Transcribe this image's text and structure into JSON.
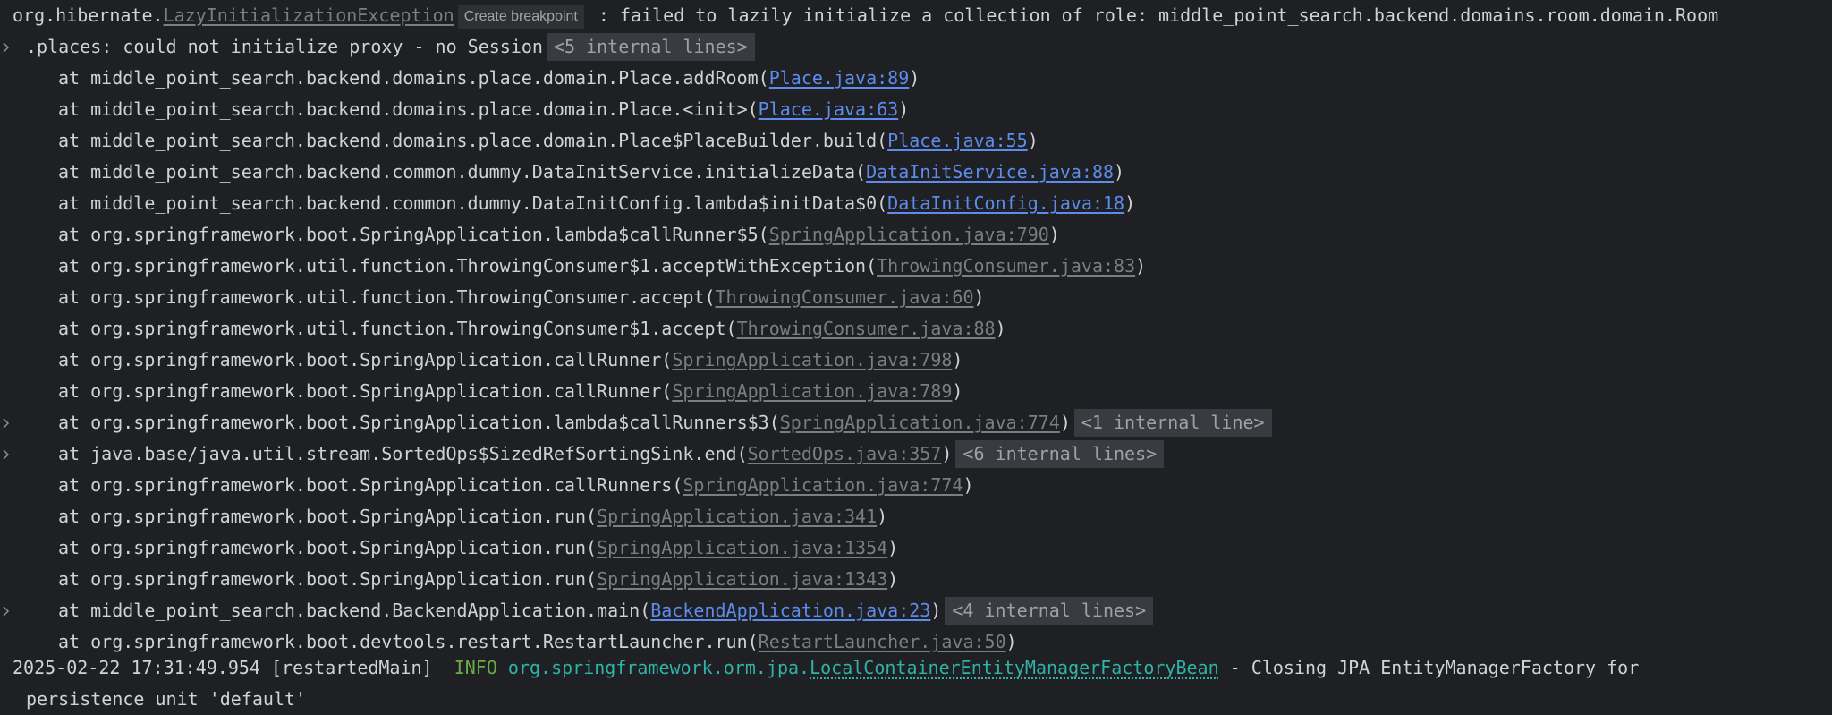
{
  "exception": {
    "prefix": "org.hibernate.",
    "class_link": "LazyInitializationException",
    "breakpoint_label": "Create breakpoint",
    "message_line1": " : failed to lazily initialize a collection of role: middle_point_search.backend.domains.room.domain.Room",
    "message_line2": ".places: could not initialize proxy - no Session",
    "internal_lines": "<5 internal lines>"
  },
  "stack": [
    {
      "method": "at middle_point_search.backend.domains.place.domain.Place.addRoom(",
      "link": "Place.java:89",
      "kind": "user",
      "suffix": ")",
      "internal": ""
    },
    {
      "method": "at middle_point_search.backend.domains.place.domain.Place.<init>(",
      "link": "Place.java:63",
      "kind": "user",
      "suffix": ")",
      "internal": ""
    },
    {
      "method": "at middle_point_search.backend.domains.place.domain.Place$PlaceBuilder.build(",
      "link": "Place.java:55",
      "kind": "user",
      "suffix": ")",
      "internal": ""
    },
    {
      "method": "at middle_point_search.backend.common.dummy.DataInitService.initializeData(",
      "link": "DataInitService.java:88",
      "kind": "user",
      "suffix": ")",
      "internal": ""
    },
    {
      "method": "at middle_point_search.backend.common.dummy.DataInitConfig.lambda$initData$0(",
      "link": "DataInitConfig.java:18",
      "kind": "user",
      "suffix": ")",
      "internal": ""
    },
    {
      "method": "at org.springframework.boot.SpringApplication.lambda$callRunner$5(",
      "link": "SpringApplication.java:790",
      "kind": "lib",
      "suffix": ")",
      "internal": ""
    },
    {
      "method": "at org.springframework.util.function.ThrowingConsumer$1.acceptWithException(",
      "link": "ThrowingConsumer.java:83",
      "kind": "lib",
      "suffix": ")",
      "internal": ""
    },
    {
      "method": "at org.springframework.util.function.ThrowingConsumer.accept(",
      "link": "ThrowingConsumer.java:60",
      "kind": "lib",
      "suffix": ")",
      "internal": ""
    },
    {
      "method": "at org.springframework.util.function.ThrowingConsumer$1.accept(",
      "link": "ThrowingConsumer.java:88",
      "kind": "lib",
      "suffix": ")",
      "internal": ""
    },
    {
      "method": "at org.springframework.boot.SpringApplication.callRunner(",
      "link": "SpringApplication.java:798",
      "kind": "lib",
      "suffix": ")",
      "internal": ""
    },
    {
      "method": "at org.springframework.boot.SpringApplication.callRunner(",
      "link": "SpringApplication.java:789",
      "kind": "lib",
      "suffix": ")",
      "internal": ""
    },
    {
      "method": "at org.springframework.boot.SpringApplication.lambda$callRunners$3(",
      "link": "SpringApplication.java:774",
      "kind": "lib",
      "suffix": ")",
      "internal": "<1 internal line>"
    },
    {
      "method": "at java.base/java.util.stream.SortedOps$SizedRefSortingSink.end(",
      "link": "SortedOps.java:357",
      "kind": "lib",
      "suffix": ")",
      "internal": "<6 internal lines>"
    },
    {
      "method": "at org.springframework.boot.SpringApplication.callRunners(",
      "link": "SpringApplication.java:774",
      "kind": "lib",
      "suffix": ")",
      "internal": ""
    },
    {
      "method": "at org.springframework.boot.SpringApplication.run(",
      "link": "SpringApplication.java:341",
      "kind": "lib",
      "suffix": ")",
      "internal": ""
    },
    {
      "method": "at org.springframework.boot.SpringApplication.run(",
      "link": "SpringApplication.java:1354",
      "kind": "lib",
      "suffix": ")",
      "internal": ""
    },
    {
      "method": "at org.springframework.boot.SpringApplication.run(",
      "link": "SpringApplication.java:1343",
      "kind": "lib",
      "suffix": ")",
      "internal": ""
    },
    {
      "method": "at middle_point_search.backend.BackendApplication.main(",
      "link": "BackendApplication.java:23",
      "kind": "user",
      "suffix": ")",
      "internal": "<4 internal lines>"
    },
    {
      "method": "at org.springframework.boot.devtools.restart.RestartLauncher.run(",
      "link": "RestartLauncher.java:50",
      "kind": "lib",
      "suffix": ")",
      "internal": ""
    }
  ],
  "log": {
    "timestamp_thread": "2025-02-22 17:31:49.954 [restartedMain]",
    "level": "INFO",
    "logger_prefix": "org.springframework.orm.jpa.",
    "logger_link": "LocalContainerEntityManagerFactoryBean",
    "message_line1": " - Closing JPA EntityManagerFactory for",
    "message_line2": "persistence unit 'default'"
  },
  "colors": {
    "background": "#1f2023",
    "text": "#cfd2d6",
    "user_link": "#5d8cec",
    "library_link": "#7a7d82",
    "info_level": "#6aab45",
    "logger": "#2fb2a8"
  },
  "icons": {
    "fold": "chevron-right-icon"
  }
}
